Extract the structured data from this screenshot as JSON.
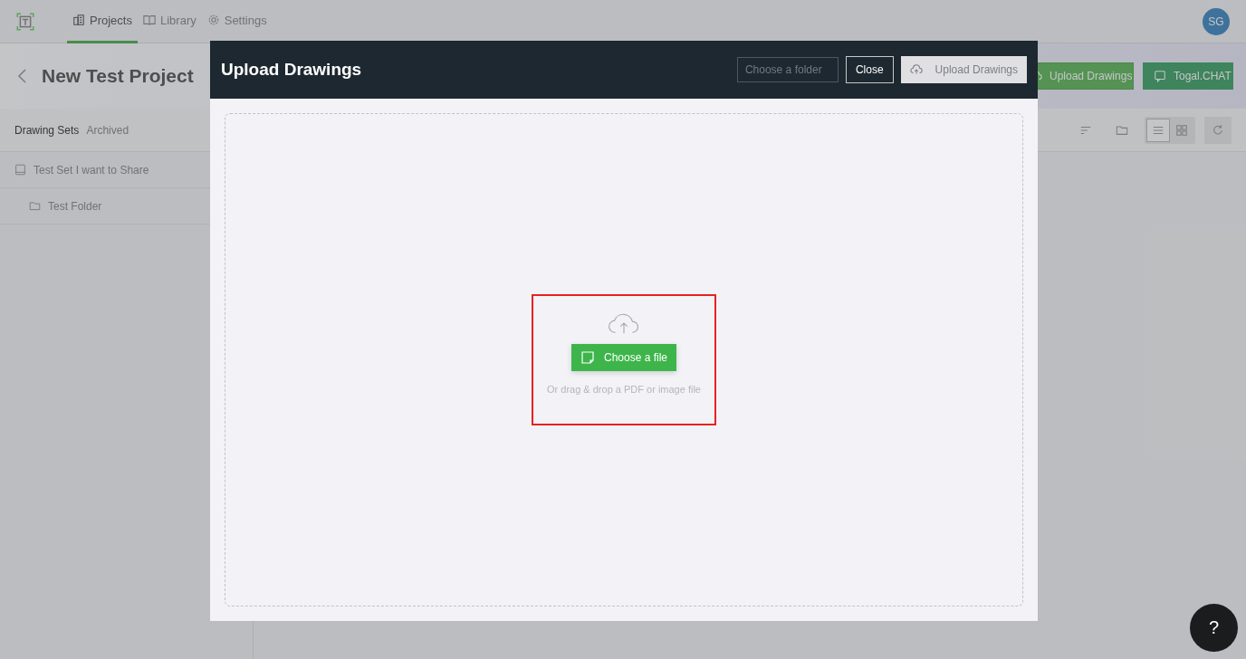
{
  "nav": {
    "tabs": [
      {
        "label": "Projects",
        "selected": true
      },
      {
        "label": "Library",
        "selected": false
      },
      {
        "label": "Settings",
        "selected": false
      }
    ],
    "avatar": "SG"
  },
  "header": {
    "title": "New Test Project",
    "buttons": [
      {
        "label": "Upload Drawings",
        "kind": "upload"
      },
      {
        "label": "Togal.CHAT",
        "kind": "chat"
      }
    ]
  },
  "subtabs": [
    {
      "label": "Drawing Sets",
      "selected": true
    },
    {
      "label": "Archived",
      "selected": false
    }
  ],
  "tree": [
    {
      "label": "Test Set I want to Share",
      "kind": "set",
      "children": [
        {
          "label": "Test Folder",
          "kind": "folder"
        }
      ]
    }
  ],
  "view_modes": [
    {
      "kind": "list",
      "selected": true
    },
    {
      "kind": "grid",
      "selected": false
    }
  ],
  "modal": {
    "title": "Upload Drawings",
    "folder_placeholder": "Choose a folder",
    "close": "Close",
    "upload": {
      "label": "Upload Drawings",
      "disabled": true
    },
    "dropzone": {
      "button": "Choose a file",
      "hint": "Or drag & drop a PDF or image file",
      "highlighted": true
    }
  },
  "help": "?"
}
